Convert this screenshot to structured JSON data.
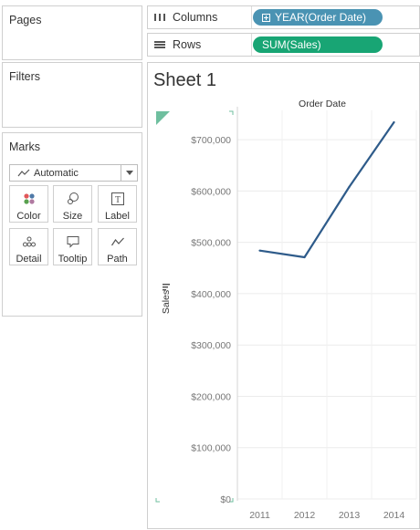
{
  "panels": {
    "pages": "Pages",
    "filters": "Filters",
    "marks": "Marks"
  },
  "marks_card": {
    "mark_type": "Automatic",
    "buttons": [
      {
        "label": "Color",
        "icon": "color-icon"
      },
      {
        "label": "Size",
        "icon": "size-icon"
      },
      {
        "label": "Label",
        "icon": "label-icon"
      },
      {
        "label": "Detail",
        "icon": "detail-icon"
      },
      {
        "label": "Tooltip",
        "icon": "tooltip-icon"
      },
      {
        "label": "Path",
        "icon": "path-icon"
      }
    ]
  },
  "shelves": {
    "columns_label": "Columns",
    "columns_pill": "YEAR(Order Date)",
    "rows_label": "Rows",
    "rows_pill": "SUM(Sales)"
  },
  "sheet": {
    "title": "Sheet 1"
  },
  "colors": {
    "columns_pill": "#4a93b3",
    "rows_pill": "#18a574",
    "line": "#2e5b8a",
    "corner_marker": "#6fbf9f"
  },
  "chart_data": {
    "type": "line",
    "title": "Order Date",
    "ylabel": "Sales",
    "xlabel": "",
    "categories": [
      "2011",
      "2012",
      "2013",
      "2014"
    ],
    "series": [
      {
        "values": [
          484000,
          471000,
          608000,
          734000
        ]
      }
    ],
    "ylim": [
      0,
      750000
    ],
    "yticks": [
      0,
      100000,
      200000,
      300000,
      400000,
      500000,
      600000,
      700000
    ],
    "ytick_labels": [
      "$0",
      "$100,000",
      "$200,000",
      "$300,000",
      "$400,000",
      "$500,000",
      "$600,000",
      "$700,000"
    ],
    "grid": true
  }
}
